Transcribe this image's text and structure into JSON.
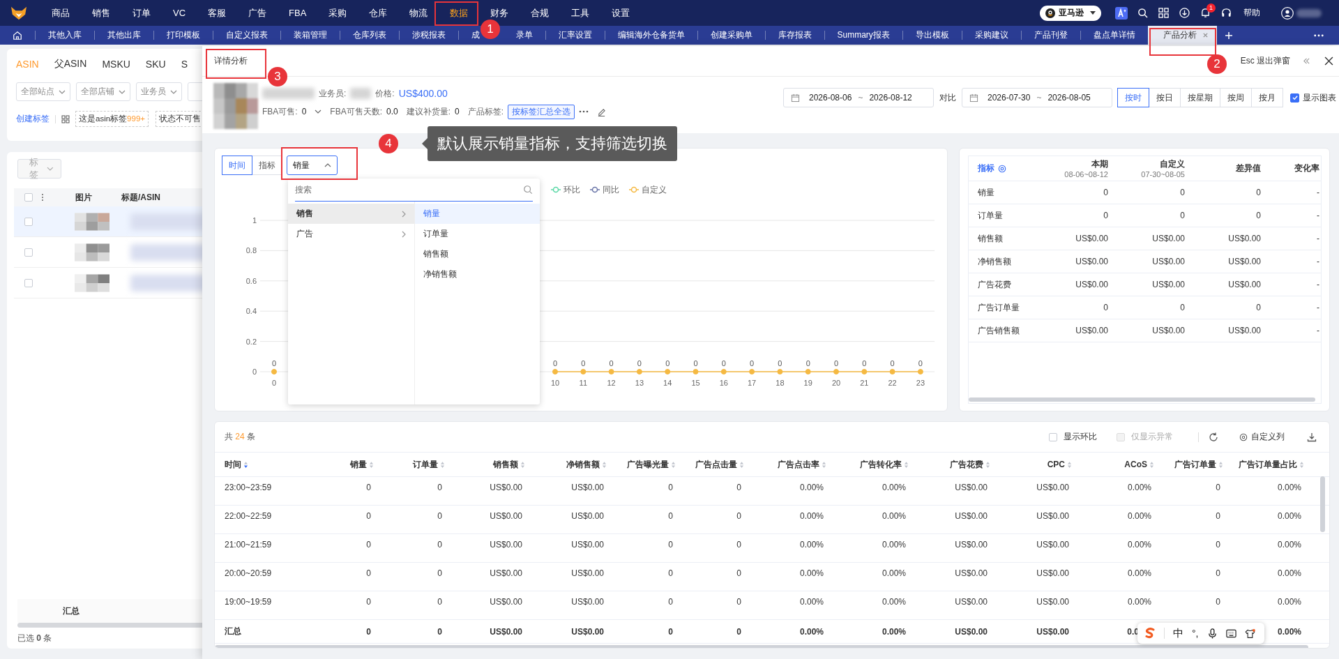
{
  "top_nav": {
    "items": [
      {
        "label": "商品",
        "selected": false
      },
      {
        "label": "销售",
        "selected": false
      },
      {
        "label": "订单",
        "selected": false
      },
      {
        "label": "VC",
        "selected": false
      },
      {
        "label": "客服",
        "selected": false
      },
      {
        "label": "广告",
        "selected": false
      },
      {
        "label": "FBA",
        "selected": false
      },
      {
        "label": "采购",
        "selected": false
      },
      {
        "label": "仓库",
        "selected": false
      },
      {
        "label": "物流",
        "selected": false
      },
      {
        "label": "数据",
        "selected": true
      },
      {
        "label": "财务",
        "selected": false
      },
      {
        "label": "合规",
        "selected": false
      },
      {
        "label": "工具",
        "selected": false
      },
      {
        "label": "设置",
        "selected": false
      }
    ],
    "marketplace": "亚马逊",
    "notification_count": "1",
    "help": "帮助"
  },
  "tab_bar": {
    "tabs": [
      {
        "label": "其他入库",
        "selected": false
      },
      {
        "label": "其他出库",
        "selected": false
      },
      {
        "label": "打印模板",
        "selected": false
      },
      {
        "label": "自定义报表",
        "selected": false
      },
      {
        "label": "装箱管理",
        "selected": false
      },
      {
        "label": "仓库列表",
        "selected": false
      },
      {
        "label": "涉税报表",
        "selected": false
      },
      {
        "label": "成",
        "label_tail": "录单",
        "selected": false
      },
      {
        "label": "汇率设置",
        "selected": false
      },
      {
        "label": "编辑海外仓备货单",
        "selected": false
      },
      {
        "label": "创建采购单",
        "selected": false
      },
      {
        "label": "库存报表",
        "selected": false
      },
      {
        "label": "Summary报表",
        "selected": false
      },
      {
        "label": "导出模板",
        "selected": false
      },
      {
        "label": "采购建议",
        "selected": false
      },
      {
        "label": "产品刊登",
        "selected": false
      },
      {
        "label": "盘点单详情",
        "selected": false
      },
      {
        "label": "产品分析",
        "selected": true,
        "closable": true
      }
    ]
  },
  "background_page": {
    "tabs": [
      {
        "label": "ASIN",
        "selected": true
      },
      {
        "label": "父ASIN",
        "selected": false
      },
      {
        "label": "MSKU",
        "selected": false
      },
      {
        "label": "SKU",
        "selected": false
      },
      {
        "label": "S",
        "selected": false
      }
    ],
    "filters": [
      {
        "placeholder": "全部站点"
      },
      {
        "placeholder": "全部店铺"
      },
      {
        "placeholder": "业务员"
      }
    ],
    "create_tag": "创建标签",
    "tags": [
      {
        "label": "这是asin标签",
        "count": "999+"
      },
      {
        "label": "状态不可售"
      }
    ],
    "tag_button": "标签",
    "header_checked": false,
    "columns": [
      "图片",
      "标题/ASIN"
    ],
    "rows": [
      {
        "highlighted": true,
        "checked": false
      },
      {
        "highlighted": false,
        "checked": false
      },
      {
        "highlighted": false,
        "checked": false
      }
    ],
    "summary": "汇总",
    "selected_count": {
      "prefix": "已选",
      "count": "0",
      "suffix": "条"
    }
  },
  "drawer": {
    "title": "详情分析",
    "esc_hint": "Esc 退出弹窗",
    "product": {
      "salesperson_label": "业务员:",
      "price_label": "价格:",
      "price": "US$400.00",
      "fba_label": "FBA可售:",
      "fba_value": "0",
      "fba_days_label": "FBA可售天数:",
      "fba_days": "0.0",
      "restock_label": "建议补货量:",
      "restock": "0",
      "tag_label": "产品标签:",
      "tag": "按标签汇总全选"
    },
    "date_range": {
      "start": "2026-08-06",
      "separator": "~",
      "end": "2026-08-12"
    },
    "compare_label": "对比",
    "compare_range": {
      "start": "2026-07-30",
      "separator": "~",
      "end": "2026-08-05"
    },
    "granularity": [
      {
        "label": "按时",
        "selected": true
      },
      {
        "label": "按日",
        "selected": false
      },
      {
        "label": "按星期",
        "selected": false
      },
      {
        "label": "按周",
        "selected": false
      },
      {
        "label": "按月",
        "selected": false
      }
    ],
    "show_chart": {
      "label": "显示图表",
      "checked": true
    },
    "chart_panel": {
      "view_toggle": [
        {
          "label": "时间",
          "selected": true
        },
        {
          "label": "指标",
          "selected": false
        }
      ],
      "metric_select": {
        "value": "销量",
        "expanded": true
      },
      "dropdown": {
        "search_placeholder": "搜索",
        "categories": [
          {
            "label": "销售",
            "selected": true
          },
          {
            "label": "广告",
            "selected": false
          }
        ],
        "options": [
          {
            "label": "销量",
            "selected": true
          },
          {
            "label": "订单量",
            "selected": false
          },
          {
            "label": "销售额",
            "selected": false
          },
          {
            "label": "净销售额",
            "selected": false
          }
        ]
      },
      "chart_data": {
        "type": "line",
        "grid": true,
        "legend": "top",
        "categories": [
          "0",
          null,
          null,
          null,
          null,
          null,
          null,
          null,
          null,
          null,
          "10",
          "11",
          "12",
          "13",
          "14",
          "15",
          "16",
          "17",
          "18",
          "19",
          "20",
          "21",
          "22",
          "23"
        ],
        "ylim": [
          0,
          1
        ],
        "yticks": [
          0,
          0.2,
          0.4,
          0.6,
          0.8,
          1
        ],
        "series": [
          {
            "name": "环比",
            "color": "#5ad8a6",
            "marker": "circle",
            "values": [
              null,
              null,
              null,
              null,
              null,
              null,
              null,
              null,
              null,
              null,
              null,
              null,
              null,
              null,
              null,
              null,
              null,
              null,
              null,
              null,
              null,
              null,
              null,
              null
            ]
          },
          {
            "name": "同比",
            "color": "#6a75a8",
            "marker": "circle",
            "values": [
              null,
              null,
              null,
              null,
              null,
              null,
              null,
              null,
              null,
              null,
              null,
              null,
              null,
              null,
              null,
              null,
              null,
              null,
              null,
              null,
              null,
              null,
              null,
              null
            ]
          },
          {
            "name": "自定义",
            "color": "#f5b942",
            "marker": "circle",
            "values": [
              0,
              null,
              null,
              null,
              null,
              null,
              null,
              null,
              null,
              null,
              0,
              0,
              0,
              0,
              0,
              0,
              0,
              0,
              0,
              0,
              0,
              0,
              0,
              0
            ],
            "value_labels": [
              "0",
              null,
              null,
              null,
              null,
              null,
              null,
              null,
              null,
              null,
              "0",
              "0",
              "0",
              "0",
              "0",
              "0",
              "0",
              "0",
              "0",
              "0",
              "0",
              "0",
              "0",
              "0"
            ]
          }
        ]
      }
    },
    "compare_table": {
      "metric_header": "指标",
      "columns": [
        {
          "label": "本期",
          "sub": "08-06~08-12"
        },
        {
          "label": "自定义",
          "sub": "07-30~08-05"
        },
        {
          "label": "差异值"
        },
        {
          "label": "变化率"
        }
      ],
      "rows": [
        {
          "metric": "销量",
          "values": [
            "0",
            "0",
            "0",
            "-"
          ]
        },
        {
          "metric": "订单量",
          "values": [
            "0",
            "0",
            "0",
            "-"
          ]
        },
        {
          "metric": "销售额",
          "values": [
            "US$0.00",
            "US$0.00",
            "US$0.00",
            "-"
          ]
        },
        {
          "metric": "净销售额",
          "values": [
            "US$0.00",
            "US$0.00",
            "US$0.00",
            "-"
          ]
        },
        {
          "metric": "广告花费",
          "values": [
            "US$0.00",
            "US$0.00",
            "US$0.00",
            "-"
          ]
        },
        {
          "metric": "广告订单量",
          "values": [
            "0",
            "0",
            "0",
            "-"
          ]
        },
        {
          "metric": "广告销售额",
          "values": [
            "US$0.00",
            "US$0.00",
            "US$0.00",
            "-"
          ]
        }
      ]
    },
    "detail_table": {
      "total": {
        "prefix": "共",
        "count": "24",
        "suffix": "条"
      },
      "show_mom": {
        "label": "显示环比",
        "checked": false
      },
      "only_abnormal": {
        "label": "仅显示异常",
        "checked": false,
        "disabled": true
      },
      "custom_columns": "自定义列",
      "columns": [
        {
          "label": "时间",
          "sorted": true,
          "descending": true
        },
        {
          "label": "销量",
          "sorted": false
        },
        {
          "label": "订单量",
          "sorted": false
        },
        {
          "label": "销售额",
          "sorted": false
        },
        {
          "label": "净销售额",
          "sorted": false
        },
        {
          "label": "广告曝光量",
          "sorted": false
        },
        {
          "label": "广告点击量",
          "sorted": false
        },
        {
          "label": "广告点击率",
          "sorted": false
        },
        {
          "label": "广告转化率",
          "sorted": false
        },
        {
          "label": "广告花费",
          "sorted": false
        },
        {
          "label": "CPC",
          "sorted": false
        },
        {
          "label": "ACoS",
          "sorted": false
        },
        {
          "label": "广告订单量",
          "sorted": false
        },
        {
          "label": "广告订单量占比",
          "sorted": false
        }
      ],
      "rows": [
        {
          "time": "23:00~23:59",
          "values": [
            "0",
            "0",
            "US$0.00",
            "US$0.00",
            "0",
            "0",
            "0.00%",
            "0.00%",
            "US$0.00",
            "US$0.00",
            "0.00%",
            "0",
            "0.00%"
          ]
        },
        {
          "time": "22:00~22:59",
          "values": [
            "0",
            "0",
            "US$0.00",
            "US$0.00",
            "0",
            "0",
            "0.00%",
            "0.00%",
            "US$0.00",
            "US$0.00",
            "0.00%",
            "0",
            "0.00%"
          ]
        },
        {
          "time": "21:00~21:59",
          "values": [
            "0",
            "0",
            "US$0.00",
            "US$0.00",
            "0",
            "0",
            "0.00%",
            "0.00%",
            "US$0.00",
            "US$0.00",
            "0.00%",
            "0",
            "0.00%"
          ]
        },
        {
          "time": "20:00~20:59",
          "values": [
            "0",
            "0",
            "US$0.00",
            "US$0.00",
            "0",
            "0",
            "0.00%",
            "0.00%",
            "US$0.00",
            "US$0.00",
            "0.00%",
            "0",
            "0.00%"
          ]
        },
        {
          "time": "19:00~19:59",
          "values": [
            "0",
            "0",
            "US$0.00",
            "US$0.00",
            "0",
            "0",
            "0.00%",
            "0.00%",
            "US$0.00",
            "US$0.00",
            "0.00%",
            "0",
            "0.00%"
          ]
        }
      ],
      "summary": {
        "label": "汇总",
        "values": [
          "0",
          "0",
          "US$0.00",
          "US$0.00",
          "0",
          "0",
          "0.00%",
          "0.00%",
          "US$0.00",
          "US$0.00",
          "0.0"
        ],
        "last_value": "0.00%"
      }
    }
  },
  "ime_toolbar": {
    "mode": "中",
    "punctuation": "°,"
  },
  "annotations": [
    {
      "number": "1"
    },
    {
      "number": "2"
    },
    {
      "number": "3"
    },
    {
      "number": "4",
      "callout": "默认展示销量指标，支持筛选切换"
    }
  ]
}
